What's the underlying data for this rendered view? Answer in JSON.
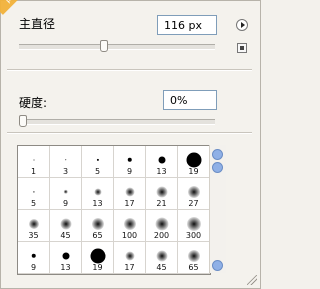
{
  "panel": {
    "watermark": "picture"
  },
  "controls": {
    "diameter_label": "主直径",
    "diameter_value": "116 px",
    "diameter_slider_percent": 43,
    "hardness_label": "硬度:",
    "hardness_value": "0%",
    "hardness_slider_percent": 0
  },
  "brushes": [
    {
      "label": "1",
      "soft": false
    },
    {
      "label": "3",
      "soft": false
    },
    {
      "label": "5",
      "soft": false
    },
    {
      "label": "9",
      "soft": false
    },
    {
      "label": "13",
      "soft": false
    },
    {
      "label": "19",
      "soft": false
    },
    {
      "label": "5",
      "soft": true
    },
    {
      "label": "9",
      "soft": true
    },
    {
      "label": "13",
      "soft": true
    },
    {
      "label": "17",
      "soft": true
    },
    {
      "label": "21",
      "soft": true
    },
    {
      "label": "27",
      "soft": true
    },
    {
      "label": "35",
      "soft": true
    },
    {
      "label": "45",
      "soft": true
    },
    {
      "label": "65",
      "soft": true
    },
    {
      "label": "100",
      "soft": true
    },
    {
      "label": "200",
      "soft": true
    },
    {
      "label": "300",
      "soft": true
    },
    {
      "label": "9",
      "soft": false
    },
    {
      "label": "13",
      "soft": false
    },
    {
      "label": "19",
      "soft": false
    },
    {
      "label": "17",
      "soft": true
    },
    {
      "label": "45",
      "soft": true
    },
    {
      "label": "65",
      "soft": true
    }
  ]
}
